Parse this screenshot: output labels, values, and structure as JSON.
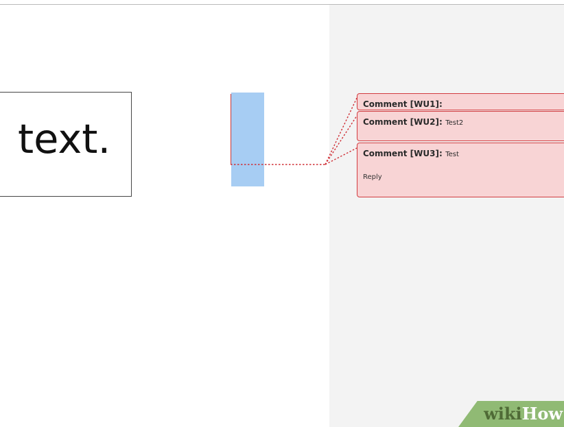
{
  "document": {
    "text_box_content": "text."
  },
  "markup_pane": {
    "comments": [
      {
        "label": "Comment [WU1]:",
        "body": ""
      },
      {
        "label": "Comment [WU2]:",
        "body": "Test2"
      },
      {
        "label": "Comment [WU3]:",
        "body": "Test",
        "reply_label": "Reply"
      }
    ]
  },
  "watermark": {
    "left": "wiki",
    "right": "How"
  },
  "colors": {
    "selection": "#a7cdf3",
    "comment_fill": "#f8d4d5",
    "comment_border": "#d23b3f",
    "markup_pane": "#f3f3f3",
    "watermark": "#90ba74"
  }
}
